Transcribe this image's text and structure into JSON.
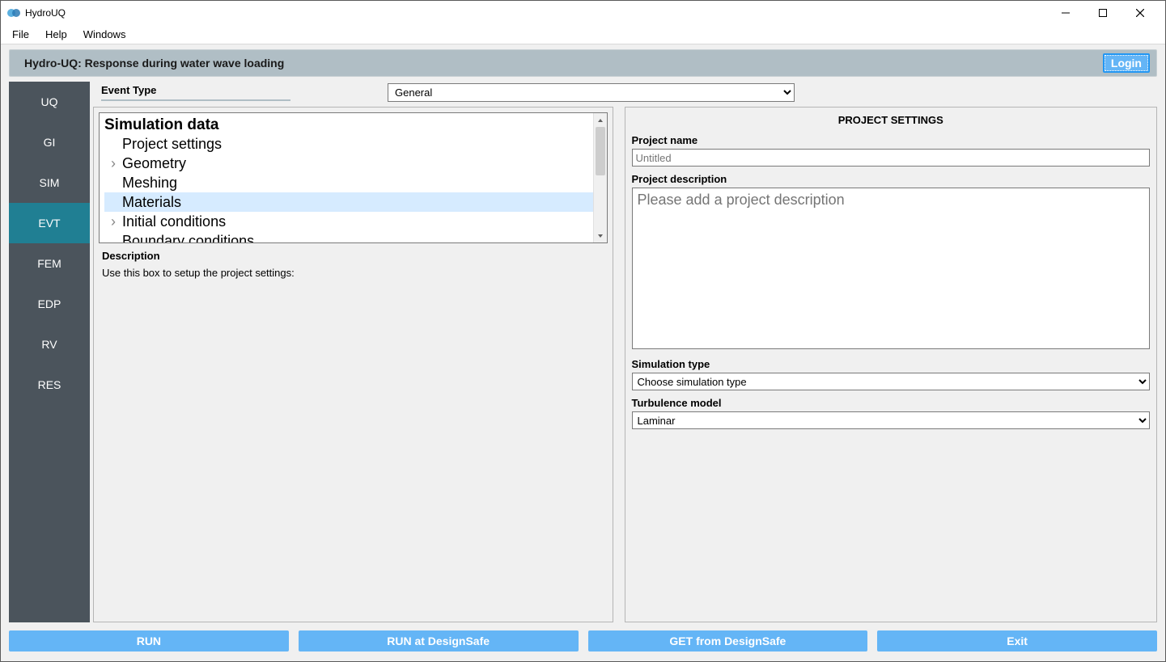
{
  "window": {
    "title": "HydroUQ"
  },
  "menubar": {
    "items": [
      "File",
      "Help",
      "Windows"
    ]
  },
  "header": {
    "title": "Hydro-UQ: Response during water wave loading",
    "login": "Login"
  },
  "sidenav": {
    "items": [
      "UQ",
      "GI",
      "SIM",
      "EVT",
      "FEM",
      "EDP",
      "RV",
      "RES"
    ],
    "active": "EVT"
  },
  "event": {
    "label": "Event Type",
    "selected": "General"
  },
  "tree": {
    "root": "Simulation data",
    "items": [
      {
        "label": "Project settings",
        "expandable": false
      },
      {
        "label": "Geometry",
        "expandable": true
      },
      {
        "label": "Meshing",
        "expandable": false
      },
      {
        "label": "Materials",
        "expandable": false,
        "selected": true
      },
      {
        "label": "Initial conditions",
        "expandable": true
      },
      {
        "label": "Boundary conditions",
        "expandable": false
      }
    ]
  },
  "description": {
    "label": "Description",
    "text": "Use this box to setup the project settings:"
  },
  "settings": {
    "title": "PROJECT SETTINGS",
    "project_name_label": "Project name",
    "project_name_placeholder": "Untitled",
    "project_desc_label": "Project description",
    "project_desc_placeholder": "Please add a project description",
    "sim_type_label": "Simulation type",
    "sim_type_selected": "Choose simulation type",
    "turb_label": "Turbulence model",
    "turb_selected": "Laminar"
  },
  "bottom": {
    "run": "RUN",
    "run_ds": "RUN at DesignSafe",
    "get_ds": "GET from DesignSafe",
    "exit": "Exit"
  }
}
